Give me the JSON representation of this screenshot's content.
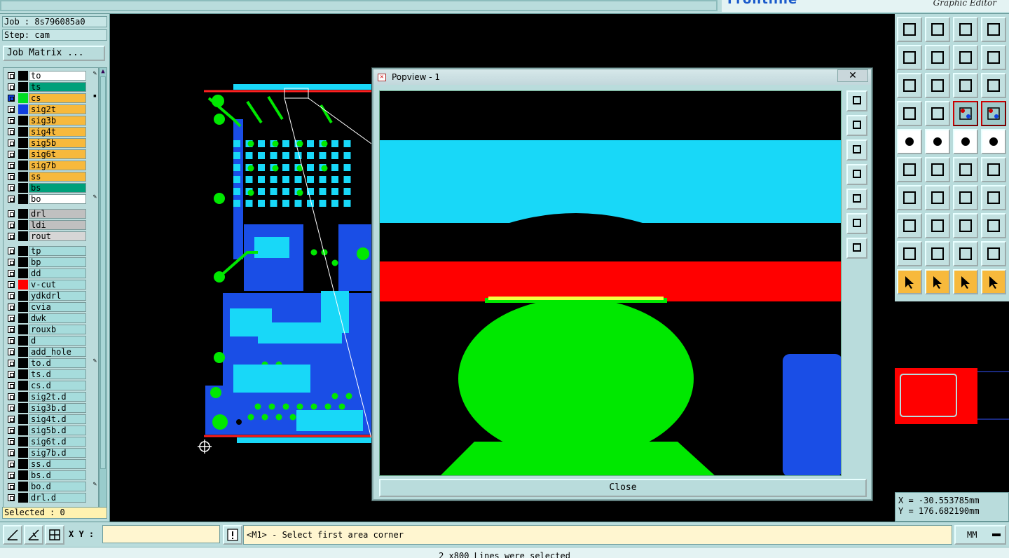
{
  "app": {
    "brand_logo": "Frontline",
    "brand_subtitle": "Graphic Editor"
  },
  "job": {
    "job_label": "Job : 8s796085a0",
    "step_label": "Step: cam",
    "matrix_button": "Job Matrix ..."
  },
  "layers": {
    "group1": [
      {
        "name": "to",
        "bg": "#ffffff",
        "color": "#000000",
        "mark": "✎"
      },
      {
        "name": "ts",
        "bg": "#00a07a",
        "color": "#000000",
        "mark": ""
      },
      {
        "name": "cs",
        "bg": "#f7b93c",
        "color": "#00dd22",
        "mark": "▪",
        "active": true
      },
      {
        "name": "sig2t",
        "bg": "#f7b93c",
        "color": "#1040e0",
        "mark": ""
      },
      {
        "name": "sig3b",
        "bg": "#f7b93c",
        "color": "#000000",
        "mark": ""
      },
      {
        "name": "sig4t",
        "bg": "#f7b93c",
        "color": "#000000",
        "mark": ""
      },
      {
        "name": "sig5b",
        "bg": "#f7b93c",
        "color": "#000000",
        "mark": ""
      },
      {
        "name": "sig6t",
        "bg": "#f7b93c",
        "color": "#000000",
        "mark": ""
      },
      {
        "name": "sig7b",
        "bg": "#f7b93c",
        "color": "#000000",
        "mark": ""
      },
      {
        "name": "ss",
        "bg": "#f7b93c",
        "color": "#000000",
        "mark": ""
      },
      {
        "name": "bs",
        "bg": "#00a07a",
        "color": "#000000",
        "mark": ""
      },
      {
        "name": "bo",
        "bg": "#ffffff",
        "color": "#000000",
        "mark": "✎"
      }
    ],
    "group2": [
      {
        "name": "drl",
        "bg": "#c0c0c0",
        "color": "#000000",
        "mark": ""
      },
      {
        "name": "ldi",
        "bg": "#c0c0c0",
        "color": "#000000",
        "mark": ""
      },
      {
        "name": "rout",
        "bg": "#d6d6d6",
        "color": "#000000",
        "mark": ""
      }
    ],
    "group3": [
      {
        "name": "tp",
        "bg": "#a6dcdc",
        "color": "#000000",
        "mark": ""
      },
      {
        "name": "bp",
        "bg": "#a6dcdc",
        "color": "#000000",
        "mark": ""
      },
      {
        "name": "dd",
        "bg": "#a6dcdc",
        "color": "#000000",
        "mark": ""
      },
      {
        "name": "v-cut",
        "bg": "#a6dcdc",
        "color": "#ff0000",
        "mark": ""
      },
      {
        "name": "ydkdrl",
        "bg": "#a6dcdc",
        "color": "#000000",
        "mark": ""
      },
      {
        "name": "cvia",
        "bg": "#a6dcdc",
        "color": "#000000",
        "mark": ""
      },
      {
        "name": "dwk",
        "bg": "#a6dcdc",
        "color": "#000000",
        "mark": ""
      },
      {
        "name": "rouxb",
        "bg": "#a6dcdc",
        "color": "#000000",
        "mark": ""
      },
      {
        "name": "d",
        "bg": "#a6dcdc",
        "color": "#000000",
        "mark": ""
      },
      {
        "name": "add_hole",
        "bg": "#a6dcdc",
        "color": "#000000",
        "mark": ""
      },
      {
        "name": "to.d",
        "bg": "#a6dcdc",
        "color": "#000000",
        "mark": "✎"
      },
      {
        "name": "ts.d",
        "bg": "#a6dcdc",
        "color": "#000000",
        "mark": ""
      },
      {
        "name": "cs.d",
        "bg": "#a6dcdc",
        "color": "#000000",
        "mark": ""
      },
      {
        "name": "sig2t.d",
        "bg": "#a6dcdc",
        "color": "#000000",
        "mark": ""
      },
      {
        "name": "sig3b.d",
        "bg": "#a6dcdc",
        "color": "#000000",
        "mark": ""
      },
      {
        "name": "sig4t.d",
        "bg": "#a6dcdc",
        "color": "#000000",
        "mark": ""
      },
      {
        "name": "sig5b.d",
        "bg": "#a6dcdc",
        "color": "#000000",
        "mark": ""
      },
      {
        "name": "sig6t.d",
        "bg": "#a6dcdc",
        "color": "#000000",
        "mark": ""
      },
      {
        "name": "sig7b.d",
        "bg": "#a6dcdc",
        "color": "#000000",
        "mark": ""
      },
      {
        "name": "ss.d",
        "bg": "#a6dcdc",
        "color": "#000000",
        "mark": ""
      },
      {
        "name": "bs.d",
        "bg": "#a6dcdc",
        "color": "#000000",
        "mark": ""
      },
      {
        "name": "bo.d",
        "bg": "#a6dcdc",
        "color": "#000000",
        "mark": "✎"
      },
      {
        "name": "drl.d",
        "bg": "#a6dcdc",
        "color": "#000000",
        "mark": ""
      }
    ]
  },
  "selection": {
    "selected_label": "Selected : 0"
  },
  "popview": {
    "title": "Popview - 1",
    "close_x": "✕",
    "close_button": "Close"
  },
  "coords": {
    "x": "X = -30.553785mm",
    "y": "Y = 176.682190mm"
  },
  "bottom": {
    "xy_label": "X Y :",
    "xy_value": "",
    "message": "<M1> - Select first area corner",
    "units": "MM",
    "status": "2 x800 Lines were selected"
  },
  "colors": {
    "panel": "#b9dcdc",
    "cyan_layer": "#18d8f8",
    "red_layer": "#ff0000",
    "green_layer": "#00e800",
    "blue_layer": "#1040e0",
    "highlight": "#f7b93c"
  }
}
